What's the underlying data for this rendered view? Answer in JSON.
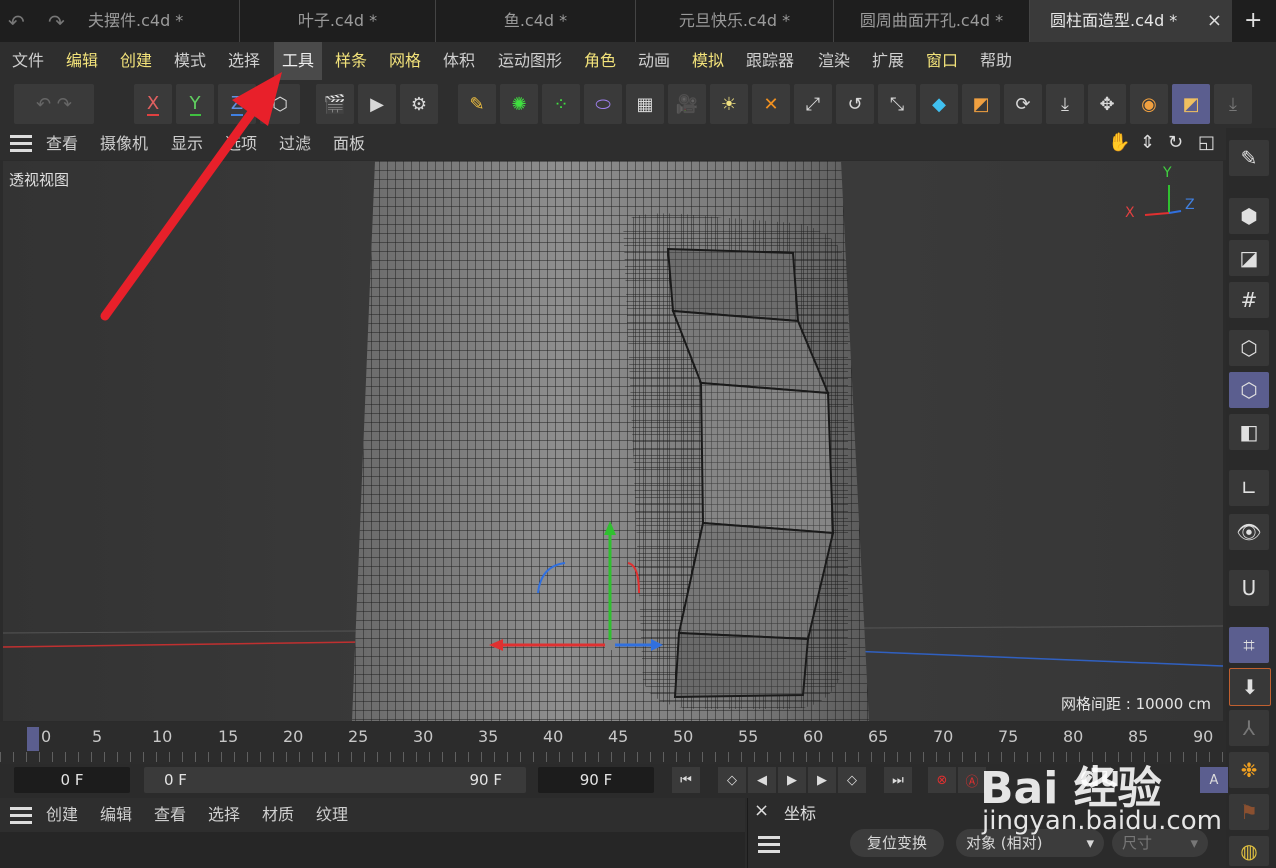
{
  "tabs": [
    {
      "label": "夫摆件.c4d *"
    },
    {
      "label": "叶子.c4d *"
    },
    {
      "label": "鱼.c4d *"
    },
    {
      "label": "元旦快乐.c4d *"
    },
    {
      "label": "圆周曲面开孔.c4d *"
    },
    {
      "label": "圆柱面造型.c4d *"
    }
  ],
  "tab_close": "×",
  "tab_add": "+",
  "menu": {
    "file": "文件",
    "edit": "编辑",
    "create": "创建",
    "mode": "模式",
    "select": "选择",
    "tools": "工具",
    "spline": "样条",
    "mesh": "网格",
    "volume": "体积",
    "mograph": "运动图形",
    "character": "角色",
    "animate": "动画",
    "simulate": "模拟",
    "tracker": "跟踪器",
    "render": "渲染",
    "extensions": "扩展",
    "window": "窗口",
    "help": "帮助"
  },
  "axes": {
    "x": "X",
    "y": "Y",
    "z": "Z"
  },
  "viewport_menu": {
    "view": "查看",
    "cameras": "摄像机",
    "display": "显示",
    "options": "选项",
    "filter": "过滤",
    "panel": "面板"
  },
  "viewport": {
    "label": "透视视图",
    "grid_spacing": "网格间距 : 10000 cm",
    "gizmo": {
      "x": "X",
      "y": "Y",
      "z": "Z"
    }
  },
  "timeline": {
    "ticks": [
      "0",
      "5",
      "10",
      "15",
      "20",
      "25",
      "30",
      "35",
      "40",
      "45",
      "50",
      "55",
      "60",
      "65",
      "70",
      "75",
      "80",
      "85",
      "90"
    ],
    "current_frame": "0 F",
    "range_start": "0 F",
    "range_end": "90 F",
    "end_frame": "90 F"
  },
  "bottom_menu": {
    "create": "创建",
    "edit": "编辑",
    "view": "查看",
    "select": "选择",
    "material": "材质",
    "texture": "纹理"
  },
  "coord_panel": {
    "close": "×",
    "title": "坐标",
    "reset_button": "复位变换",
    "mode_select": "对象 (相对)",
    "size_select": "尺寸"
  },
  "watermark": {
    "brand": "Bai 经验",
    "paw": "du",
    "url": "jingyan.baidu.com"
  },
  "colors": {
    "accent": "#5b5e8f",
    "highlight_menu": "#f2e27a",
    "arrow": "#e8202a",
    "x_axis": "#e04040",
    "y_axis": "#40c040",
    "z_axis": "#4080e0"
  }
}
